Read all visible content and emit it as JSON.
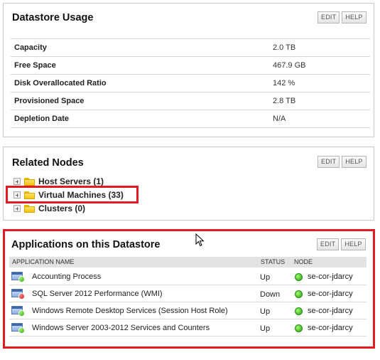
{
  "datastore_usage": {
    "title": "Datastore Usage",
    "edit_label": "EDIT",
    "help_label": "HELP",
    "rows": [
      {
        "label": "Capacity",
        "value": "2.0 TB"
      },
      {
        "label": "Free Space",
        "value": "467.9 GB"
      },
      {
        "label": "Disk Overallocated Ratio",
        "value": "142 %"
      },
      {
        "label": "Provisioned Space",
        "value": "2.8 TB"
      },
      {
        "label": "Depletion Date",
        "value": "N/A"
      }
    ]
  },
  "related_nodes": {
    "title": "Related Nodes",
    "edit_label": "EDIT",
    "help_label": "HELP",
    "items": [
      {
        "label": "Host Servers (1)",
        "icon": "folder-icon"
      },
      {
        "label": "Virtual Machines (33)",
        "icon": "folder-icon"
      },
      {
        "label": "Clusters (0)",
        "icon": "folder-icon"
      }
    ]
  },
  "applications": {
    "title": "Applications on this Datastore",
    "edit_label": "EDIT",
    "help_label": "HELP",
    "columns": {
      "name": "APPLICATION NAME",
      "status": "STATUS",
      "node": "NODE"
    },
    "rows": [
      {
        "name": "Accounting Process",
        "status": "Up",
        "node": "se-cor-jdarcy",
        "status_color": "#2aa60e"
      },
      {
        "name": "SQL Server 2012 Performance (WMI)",
        "status": "Down",
        "node": "se-cor-jdarcy",
        "status_color": "#d01010"
      },
      {
        "name": "Windows Remote Desktop Services (Session Host Role)",
        "status": "Up",
        "node": "se-cor-jdarcy",
        "status_color": "#2aa60e"
      },
      {
        "name": "Windows Server 2003-2012 Services and Counters",
        "status": "Up",
        "node": "se-cor-jdarcy",
        "status_color": "#2aa60e"
      }
    ]
  },
  "colors": {
    "highlight": "#e01b24",
    "node_up": "#23a20c"
  }
}
